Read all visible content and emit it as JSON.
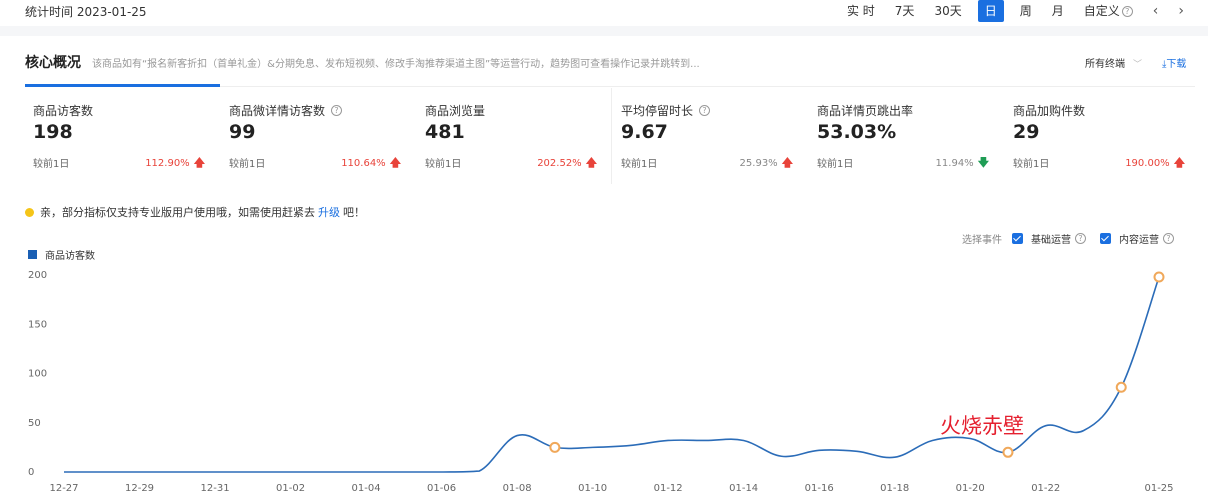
{
  "header": {
    "stat_time": "统计时间 2023-01-25",
    "periods": [
      "实 时",
      "7天",
      "30天",
      "日",
      "周",
      "月"
    ],
    "active_period": "日",
    "custom": "自定义",
    "prev": "‹",
    "next": "›"
  },
  "core": {
    "title": "核心概况",
    "description": "该商品如有“报名新客折扣（首单礼金）&分期免息、发布短视频、修改手淘推荐渠道主图”等运营行动，趋势图可查看操作记录并跳转到...",
    "terminal": "所有终端",
    "download": "下载"
  },
  "metrics": [
    {
      "label": "商品访客数",
      "value": "198",
      "compare": "较前1日",
      "change": "112.90%",
      "direction": "up",
      "help": false
    },
    {
      "label": "商品微详情访客数",
      "value": "99",
      "compare": "较前1日",
      "change": "110.64%",
      "direction": "up",
      "help": true
    },
    {
      "label": "商品浏览量",
      "value": "481",
      "compare": "较前1日",
      "change": "202.52%",
      "direction": "up",
      "help": false
    },
    {
      "label": "平均停留时长",
      "value": "9.67",
      "compare": "较前1日",
      "change": "25.93%",
      "direction": "up",
      "help": true
    },
    {
      "label": "商品详情页跳出率",
      "value": "53.03%",
      "compare": "较前1日",
      "change": "11.94%",
      "direction": "down",
      "help": false
    },
    {
      "label": "商品加购件数",
      "value": "29",
      "compare": "较前1日",
      "change": "190.00%",
      "direction": "up",
      "help": false
    }
  ],
  "notice": {
    "text_before": "亲，部分指标仅支持专业版用户使用哦，如需使用赶紧去",
    "link": "升级",
    "text_after": "吧！"
  },
  "events": {
    "label": "选择事件",
    "items": [
      "基础运营",
      "内容运营"
    ]
  },
  "watermark": "火烧赤壁",
  "colors": {
    "accent": "#1a6fe0",
    "line": "#2b6cb8",
    "up": "#e8433a",
    "down": "#1f9d55",
    "event_marker": "#f0a85a"
  },
  "chart_data": {
    "type": "line",
    "series": [
      {
        "name": "商品访客数",
        "values": [
          0,
          0,
          0,
          0,
          0,
          0,
          0,
          0,
          0,
          0,
          0,
          0,
          0,
          0,
          1,
          37,
          25,
          25,
          27,
          32,
          32,
          32,
          16,
          22,
          21,
          15,
          32,
          34,
          20,
          47,
          42,
          86,
          198
        ]
      }
    ],
    "x": [
      "12-27",
      "12-28",
      "12-29",
      "12-30",
      "12-31",
      "01-01",
      "01-02",
      "01-03",
      "01-04",
      "01-05",
      "01-06",
      "01-07",
      "01-08",
      "01-09",
      "01-10",
      "01-11",
      "01-12",
      "01-13",
      "01-14",
      "01-15",
      "01-16",
      "01-17",
      "01-18",
      "01-19",
      "01-20",
      "01-21",
      "01-22",
      "01-23",
      "01-24",
      "01-25"
    ],
    "x_ticks": [
      "12-27",
      "12-29",
      "12-31",
      "01-02",
      "01-04",
      "01-06",
      "01-08",
      "01-10",
      "01-12",
      "01-14",
      "01-16",
      "01-18",
      "01-20",
      "01-22",
      "01-25"
    ],
    "y_ticks": [
      0,
      50,
      100,
      150,
      200
    ],
    "ylim": [
      0,
      200
    ],
    "markers": [
      {
        "x": "01-09",
        "y": 1
      },
      {
        "x": "01-21",
        "y": 20
      },
      {
        "x": "01-24",
        "y": 86
      },
      {
        "x": "01-25",
        "y": 198
      }
    ],
    "grid": false,
    "legend": "top-left"
  }
}
